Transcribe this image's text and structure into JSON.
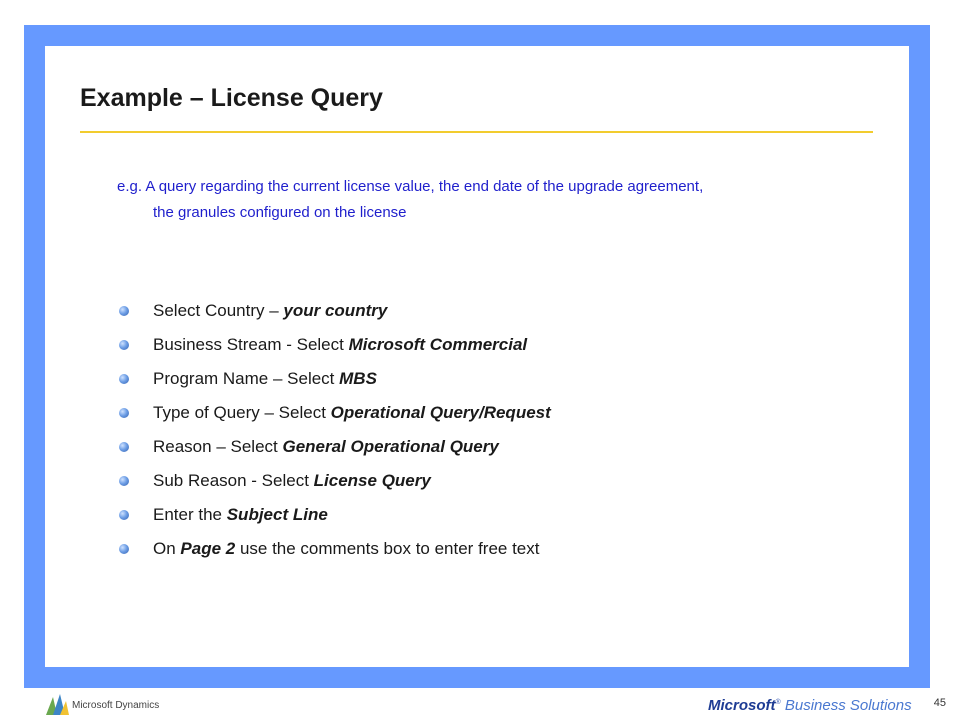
{
  "slide": {
    "title": "Example – License Query",
    "intro_line1": "e.g. A query regarding the current license value, the end date of the upgrade agreement,",
    "intro_line2": "the granules configured on the license",
    "bullets": [
      {
        "plain": "Select Country –  ",
        "emph": "your country",
        "tail": ""
      },
      {
        "plain": "Business Stream - Select ",
        "emph": "Microsoft Commercial",
        "tail": ""
      },
      {
        "plain": "Program Name – Select ",
        "emph": "MBS",
        "tail": ""
      },
      {
        "plain": "Type of Query – Select ",
        "emph": "Operational Query/Request",
        "tail": ""
      },
      {
        "plain": "Reason – Select ",
        "emph": "General Operational Query",
        "tail": ""
      },
      {
        "plain": "Sub Reason - Select ",
        "emph": "License Query",
        "tail": ""
      },
      {
        "plain": "Enter the ",
        "emph": "Subject Line",
        "tail": ""
      },
      {
        "plain": "On ",
        "emph": "Page 2",
        "tail": " use the comments box to enter free text"
      }
    ]
  },
  "footer": {
    "page_number": "45",
    "left_logo_text": "Microsoft Dynamics",
    "right_logo_brand": "Microsoft",
    "right_logo_suffix": "Business Solutions"
  },
  "colors": {
    "frame": "#6699ff",
    "title_rule": "#f2cc2e",
    "intro_text": "#1f1fcc"
  }
}
